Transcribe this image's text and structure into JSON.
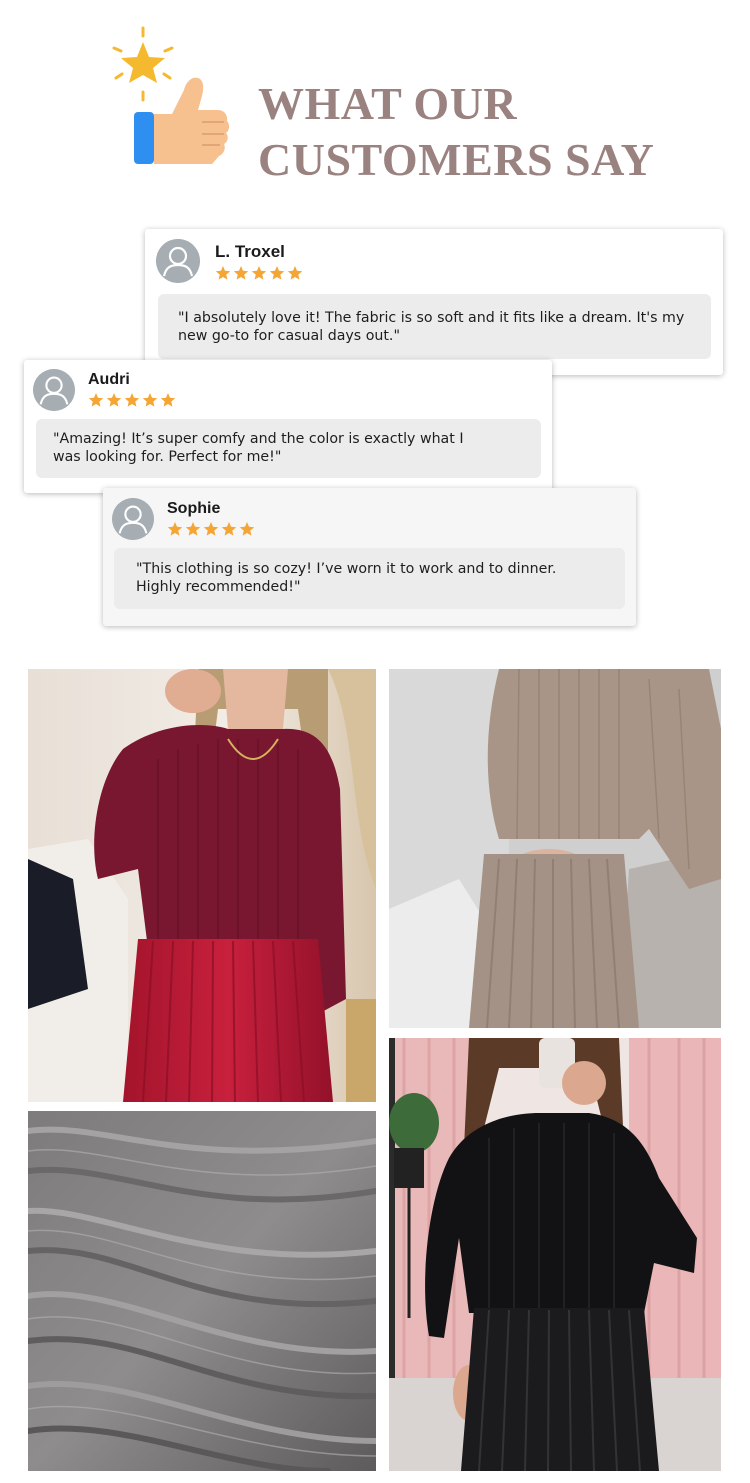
{
  "header": {
    "title_line1": "WHAT OUR",
    "title_line2": "CUSTOMERS SAY",
    "icon": "thumbs-up-star-icon",
    "title_color": "#9a8280"
  },
  "reviews": [
    {
      "name": "L. Troxel",
      "rating": 5,
      "quote": "\"I absolutely love it! The fabric is so soft and it fits like a dream. It's my new go-to for casual days out.\""
    },
    {
      "name": "Audri",
      "rating": 5,
      "quote": "\"Amazing! It’s super comfy and the color is exactly what I was looking for. Perfect for me!\""
    },
    {
      "name": "Sophie",
      "rating": 5,
      "quote": "\"This clothing is so cozy! I’ve worn it to work and to dinner. Highly recommended!\""
    }
  ],
  "colors": {
    "star": "#f5a533",
    "avatar": "#a6aeb3",
    "quote_bg": "#ececec"
  },
  "gallery": [
    {
      "subject": "burgundy-knit-sweater-red-pleated-skirt-photo"
    },
    {
      "subject": "taupe-knit-sweater-pleated-skirt-photo"
    },
    {
      "subject": "grey-pleated-fabric-closeup-photo"
    },
    {
      "subject": "black-knit-sweater-black-pleated-skirt-photo"
    }
  ]
}
